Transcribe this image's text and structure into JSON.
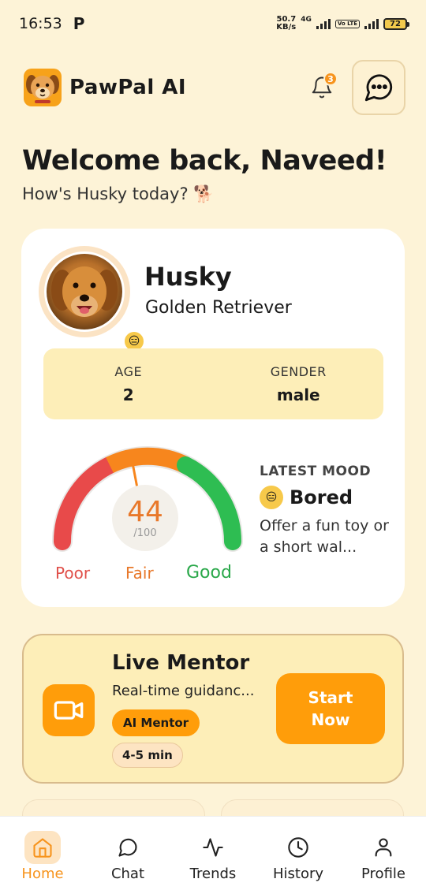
{
  "status_bar": {
    "time": "16:53",
    "carrier_icon": "P",
    "net_speed_value": "50.7",
    "net_speed_unit": "KB/s",
    "network_type": "4G",
    "volte_label": "Vo LTE",
    "battery": "72"
  },
  "header": {
    "app_name": "PawPal AI",
    "notification_count": "3"
  },
  "welcome": {
    "title": "Welcome back, Naveed!",
    "subtitle": "How's Husky today? 🐕"
  },
  "pet": {
    "name": "Husky",
    "breed": "Golden Retriever",
    "mood_emoji": "😑",
    "age_label": "AGE",
    "age": "2",
    "gender_label": "GENDER",
    "gender": "male"
  },
  "gauge": {
    "score": "44",
    "max": "/100",
    "score_fraction": 0.44,
    "label_poor": "Poor",
    "label_fair": "Fair",
    "label_good": "Good"
  },
  "mood": {
    "title": "LATEST MOOD",
    "emoji": "😑",
    "value": "Bored",
    "description": "Offer a fun toy or a short wal..."
  },
  "mentor": {
    "title": "Live Mentor",
    "description": "Real-time guidanc...",
    "tag_primary": "AI Mentor",
    "tag_duration": "4-5 min",
    "button_label": "Start Now"
  },
  "nav": {
    "items": [
      {
        "label": "Home",
        "icon": "home-icon"
      },
      {
        "label": "Chat",
        "icon": "chat-icon"
      },
      {
        "label": "Trends",
        "icon": "activity-icon"
      },
      {
        "label": "History",
        "icon": "clock-icon"
      },
      {
        "label": "Profile",
        "icon": "user-icon"
      }
    ]
  },
  "colors": {
    "background": "#fdf3d7",
    "accent": "#ff9d0a",
    "gauge_poor": "#e84a4a",
    "gauge_fair": "#f7861d",
    "gauge_good": "#2ebd52"
  }
}
